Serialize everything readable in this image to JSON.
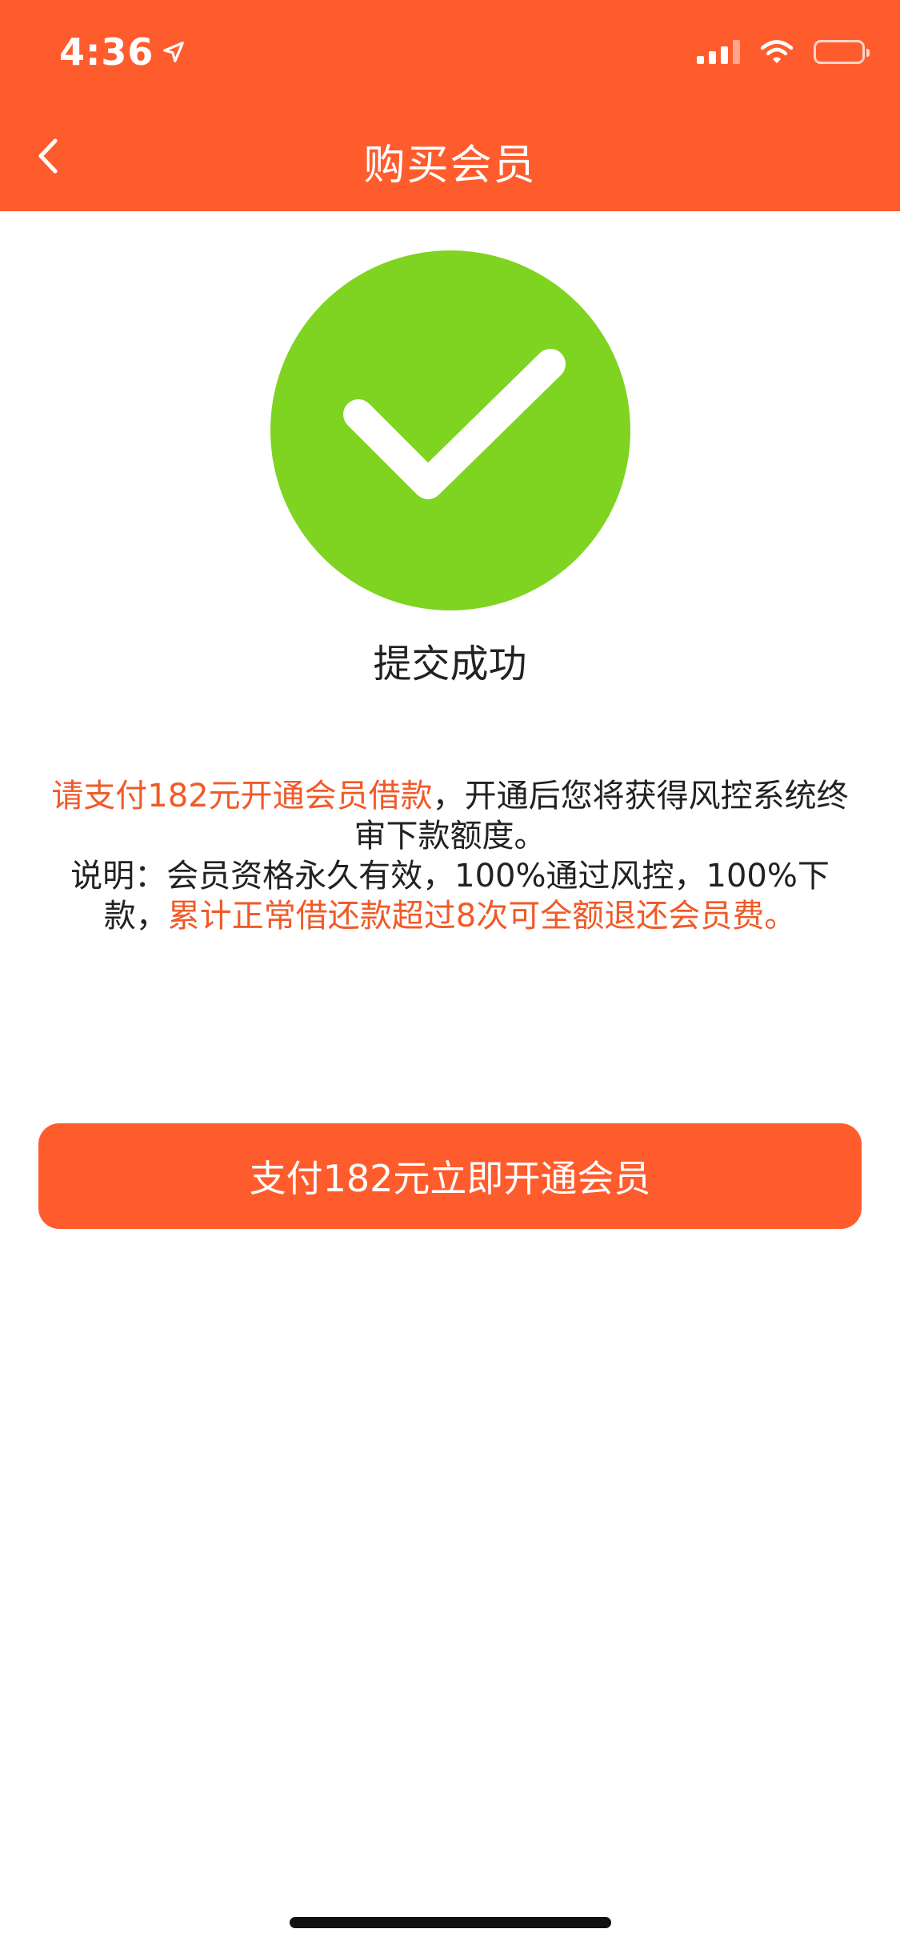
{
  "status_bar": {
    "time": "4:36",
    "location_icon": "location-arrow-icon",
    "signal_icon": "cellular-signal-icon",
    "wifi_icon": "wifi-icon",
    "battery_icon": "battery-icon"
  },
  "nav": {
    "back_icon": "chevron-left-icon",
    "title": "购买会员"
  },
  "success": {
    "icon": "checkmark-circle-icon",
    "icon_color": "#7FD321",
    "label": "提交成功"
  },
  "description": {
    "line1_highlight": "请支付182元开通会员借款",
    "line1_rest": "，开通后您将获得风控系统终审下款额度。",
    "line2_plain": "说明：会员资格永久有效，100%通过风控，100%下款，",
    "line2_highlight": "累计正常借还款超过8次可全额退还会员费。"
  },
  "pay_button": {
    "label": "支付182元立即开通会员"
  },
  "colors": {
    "brand": "#FF5C2D",
    "highlight_text": "#F05A28",
    "success_green": "#7FD321"
  }
}
